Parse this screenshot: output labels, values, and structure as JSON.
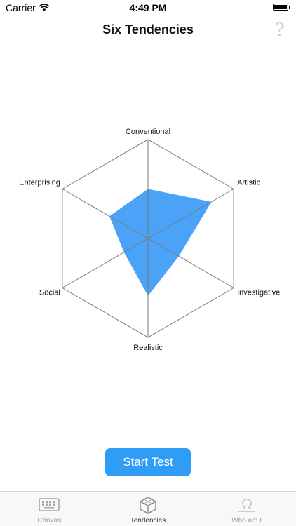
{
  "status_bar": {
    "carrier": "Carrier",
    "time": "4:49 PM",
    "wifi_icon": "wifi-icon",
    "battery_icon": "battery-icon",
    "battery_level": 1.0
  },
  "nav": {
    "title": "Six Tendencies",
    "help_icon": "question-mark-icon",
    "help_glyph": "?"
  },
  "chart_data": {
    "type": "radar",
    "axes": [
      "Conventional",
      "Artistic",
      "Investigative",
      "Realistic",
      "Social",
      "Enterprising"
    ],
    "values": [
      0.5,
      0.74,
      0.36,
      0.58,
      0.28,
      0.45
    ],
    "range": [
      0,
      1
    ],
    "grid": true,
    "fill_color": "#4aa3f7",
    "grid_color": "#7a7a7a"
  },
  "actions": {
    "start_test": "Start Test",
    "button_color": "#2f9df5"
  },
  "tabs": [
    {
      "label": "Canvas",
      "icon": "keyboard-icon",
      "active": false
    },
    {
      "label": "Tendencies",
      "icon": "cube-icon",
      "active": true
    },
    {
      "label": "Who am I",
      "icon": "omega-icon",
      "active": false
    }
  ]
}
